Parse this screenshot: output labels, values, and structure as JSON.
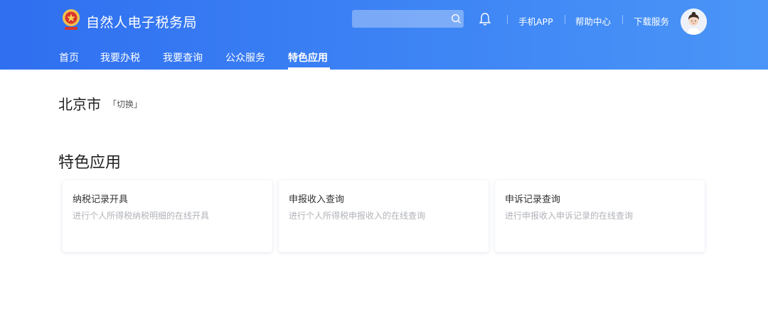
{
  "header": {
    "title": "自然人电子税务局",
    "emblem_icon": "tax-emblem-icon",
    "search": {
      "placeholder": "",
      "value": ""
    },
    "links": [
      "手机APP",
      "帮助中心",
      "下载服务"
    ],
    "nav": [
      {
        "label": "首页",
        "active": false
      },
      {
        "label": "我要办税",
        "active": false
      },
      {
        "label": "我要查询",
        "active": false
      },
      {
        "label": "公众服务",
        "active": false
      },
      {
        "label": "特色应用",
        "active": true
      }
    ]
  },
  "location": {
    "city": "北京市",
    "switch_label": "「切换」"
  },
  "section": {
    "title": "特色应用"
  },
  "cards": [
    {
      "title": "纳税记录开具",
      "desc": "进行个人所得税纳税明细的在线开具"
    },
    {
      "title": "申报收入查询",
      "desc": "进行个人所得税申报收入的在线查询"
    },
    {
      "title": "申诉记录查询",
      "desc": "进行申报收入申诉记录的在线查询"
    }
  ],
  "colors": {
    "header_start": "#2f6ff0",
    "header_end": "#4a95f7",
    "desc_text": "#b0b3b8"
  }
}
